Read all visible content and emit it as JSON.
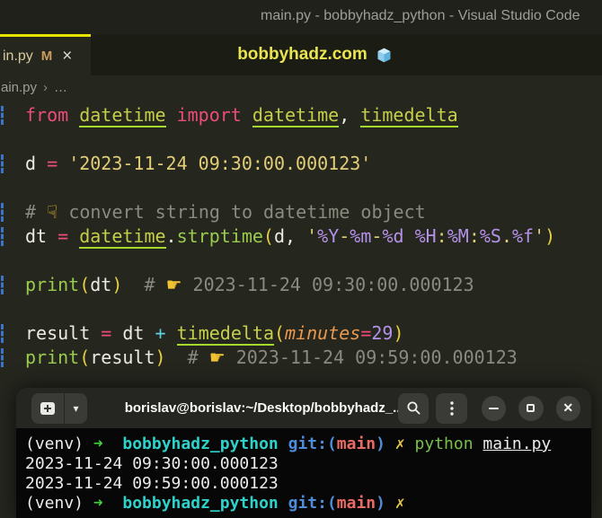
{
  "window": {
    "title": "main.py - bobbyhadz_python - Visual Studio Code"
  },
  "tabs": {
    "active_label": "in.py",
    "modified_badge": "M",
    "close_glyph": "×",
    "center_title": "bobbyhadz.com"
  },
  "breadcrumb": {
    "file": "ain.py",
    "sep": "›",
    "more": "…"
  },
  "colors": {
    "tab_accent": "#e7e200",
    "editor_bg": "#25261e",
    "keyword_pink": "#ec4c7a",
    "module_green": "#c5cf4a",
    "string_yellow": "#e2ce79",
    "format_purple": "#b592ea",
    "comment_gray": "#888b7f",
    "terminal_cyan": "#2fd2cb",
    "terminal_blue": "#4f8cd8",
    "terminal_red": "#e96b63",
    "terminal_green": "#3fd23c"
  },
  "editor": {
    "lines": [
      {
        "changed": true,
        "tokens": [
          {
            "t": "from ",
            "s": "kw"
          },
          {
            "t": "datetime",
            "s": "mod"
          },
          {
            "t": " import ",
            "s": "kw"
          },
          {
            "t": "datetime",
            "s": "mod"
          },
          {
            "t": ", ",
            "s": "var"
          },
          {
            "t": "timedelta",
            "s": "mod"
          }
        ]
      },
      {
        "changed": false,
        "tokens": []
      },
      {
        "changed": true,
        "tokens": [
          {
            "t": "d ",
            "s": "var"
          },
          {
            "t": "= ",
            "s": "kw"
          },
          {
            "t": "'2023-11-24 09:30:00.000123'",
            "s": "str"
          }
        ]
      },
      {
        "changed": false,
        "tokens": []
      },
      {
        "changed": true,
        "tokens": [
          {
            "t": "# ",
            "s": "com"
          },
          {
            "t": "☟",
            "s": "emoji"
          },
          {
            "t": " convert string to datetime object",
            "s": "com"
          }
        ]
      },
      {
        "changed": true,
        "tokens": [
          {
            "t": "dt ",
            "s": "var"
          },
          {
            "t": "= ",
            "s": "kw"
          },
          {
            "t": "datetime",
            "s": "mod"
          },
          {
            "t": ".",
            "s": "var"
          },
          {
            "t": "strptime",
            "s": "fn"
          },
          {
            "t": "(",
            "s": "par"
          },
          {
            "t": "d",
            "s": "var"
          },
          {
            "t": ", ",
            "s": "var"
          },
          {
            "t": "'",
            "s": "str"
          },
          {
            "t": "%Y",
            "s": "fmt"
          },
          {
            "t": "-",
            "s": "str"
          },
          {
            "t": "%m",
            "s": "fmt"
          },
          {
            "t": "-",
            "s": "str"
          },
          {
            "t": "%d",
            "s": "fmt"
          },
          {
            "t": " ",
            "s": "str"
          },
          {
            "t": "%H",
            "s": "fmt"
          },
          {
            "t": ":",
            "s": "str"
          },
          {
            "t": "%M",
            "s": "fmt"
          },
          {
            "t": ":",
            "s": "str"
          },
          {
            "t": "%S",
            "s": "fmt"
          },
          {
            "t": ".",
            "s": "str"
          },
          {
            "t": "%f",
            "s": "fmt"
          },
          {
            "t": "'",
            "s": "str"
          },
          {
            "t": ")",
            "s": "par"
          }
        ]
      },
      {
        "changed": false,
        "tokens": []
      },
      {
        "changed": true,
        "tokens": [
          {
            "t": "print",
            "s": "fn"
          },
          {
            "t": "(",
            "s": "par"
          },
          {
            "t": "dt",
            "s": "var"
          },
          {
            "t": ")",
            "s": "par"
          },
          {
            "t": "  # ",
            "s": "com"
          },
          {
            "t": "☛",
            "s": "emoji"
          },
          {
            "t": " 2023-11-24 09:30:00.000123",
            "s": "com"
          }
        ]
      },
      {
        "changed": false,
        "tokens": []
      },
      {
        "changed": true,
        "tokens": [
          {
            "t": "result ",
            "s": "var"
          },
          {
            "t": "= ",
            "s": "kw"
          },
          {
            "t": "dt ",
            "s": "var"
          },
          {
            "t": "+ ",
            "s": "op"
          },
          {
            "t": "timedelta",
            "s": "mod"
          },
          {
            "t": "(",
            "s": "par"
          },
          {
            "t": "minutes",
            "s": "param"
          },
          {
            "t": "=",
            "s": "kw"
          },
          {
            "t": "29",
            "s": "num"
          },
          {
            "t": ")",
            "s": "par"
          }
        ]
      },
      {
        "changed": true,
        "tokens": [
          {
            "t": "print",
            "s": "fn"
          },
          {
            "t": "(",
            "s": "par"
          },
          {
            "t": "result",
            "s": "var"
          },
          {
            "t": ")",
            "s": "par"
          },
          {
            "t": "  # ",
            "s": "com"
          },
          {
            "t": "☛",
            "s": "emoji"
          },
          {
            "t": " 2023-11-24 09:59:00.000123",
            "s": "com"
          }
        ]
      }
    ]
  },
  "terminal": {
    "title": "borislav@borislav:~/Desktop/bobbyhadz_...",
    "icons": {
      "caret": "▾",
      "close": "✕"
    },
    "lines": [
      [
        {
          "t": "(venv) ",
          "s": "w"
        },
        {
          "t": "➜  ",
          "s": "grn"
        },
        {
          "t": "bobbyhadz_python ",
          "s": "cyn"
        },
        {
          "t": "git:(",
          "s": "blu"
        },
        {
          "t": "main",
          "s": "red"
        },
        {
          "t": ") ",
          "s": "blu"
        },
        {
          "t": "✗ ",
          "s": "yel"
        },
        {
          "t": "python ",
          "s": "pyg"
        },
        {
          "t": "main.py",
          "s": "fileu"
        }
      ],
      [
        {
          "t": "2023-11-24 09:30:00.000123",
          "s": "w"
        }
      ],
      [
        {
          "t": "2023-11-24 09:59:00.000123",
          "s": "w"
        }
      ],
      [
        {
          "t": "(venv) ",
          "s": "w"
        },
        {
          "t": "➜  ",
          "s": "grn"
        },
        {
          "t": "bobbyhadz_python ",
          "s": "cyn"
        },
        {
          "t": "git:(",
          "s": "blu"
        },
        {
          "t": "main",
          "s": "red"
        },
        {
          "t": ") ",
          "s": "blu"
        },
        {
          "t": "✗",
          "s": "yel"
        }
      ]
    ]
  }
}
